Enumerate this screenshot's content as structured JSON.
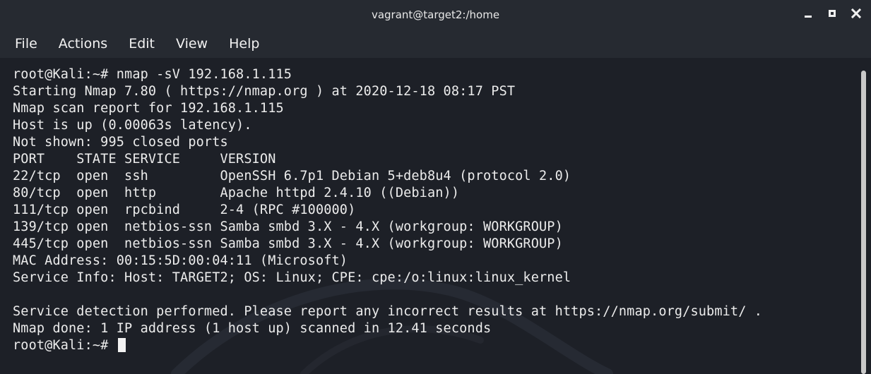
{
  "window": {
    "title": "vagrant@target2:/home",
    "controls": [
      "minimize",
      "maximize",
      "close"
    ]
  },
  "menu": {
    "items": [
      "File",
      "Actions",
      "Edit",
      "View",
      "Help"
    ]
  },
  "terminal": {
    "lines": [
      "root@Kali:~# nmap -sV 192.168.1.115",
      "Starting Nmap 7.80 ( https://nmap.org ) at 2020-12-18 08:17 PST",
      "Nmap scan report for 192.168.1.115",
      "Host is up (0.00063s latency).",
      "Not shown: 995 closed ports",
      "PORT    STATE SERVICE     VERSION",
      "22/tcp  open  ssh         OpenSSH 6.7p1 Debian 5+deb8u4 (protocol 2.0)",
      "80/tcp  open  http        Apache httpd 2.4.10 ((Debian))",
      "111/tcp open  rpcbind     2-4 (RPC #100000)",
      "139/tcp open  netbios-ssn Samba smbd 3.X - 4.X (workgroup: WORKGROUP)",
      "445/tcp open  netbios-ssn Samba smbd 3.X - 4.X (workgroup: WORKGROUP)",
      "MAC Address: 00:15:5D:00:04:11 (Microsoft)",
      "Service Info: Host: TARGET2; OS: Linux; CPE: cpe:/o:linux:linux_kernel",
      "",
      "Service detection performed. Please report any incorrect results at https://nmap.org/submit/ .",
      "Nmap done: 1 IP address (1 host up) scanned in 12.41 seconds"
    ],
    "prompt": "root@Kali:~# "
  },
  "icons": {
    "minimize": "minimize-icon",
    "maximize": "maximize-icon",
    "close": "close-icon",
    "watermark": "kali-dragon-watermark"
  },
  "colors": {
    "background": "#1d2027",
    "titlebar": "#262a31",
    "text": "#ececec"
  }
}
